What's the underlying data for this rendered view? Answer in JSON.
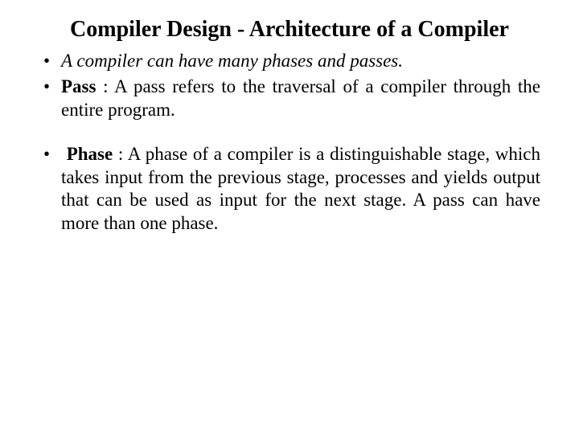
{
  "title": "Compiler Design - Architecture of a Compiler",
  "bullets": {
    "b1": "A compiler can have many phases and passes.",
    "b2_term": "Pass",
    "b2_rest": " : A pass refers to the traversal of a compiler through the entire program.",
    "b3_term": "Phase",
    "b3_rest": " : A phase of a compiler is a distinguishable stage, which takes input from the previous stage, processes and yields output that can be used as input for the next stage. A pass can have more than one phase."
  }
}
